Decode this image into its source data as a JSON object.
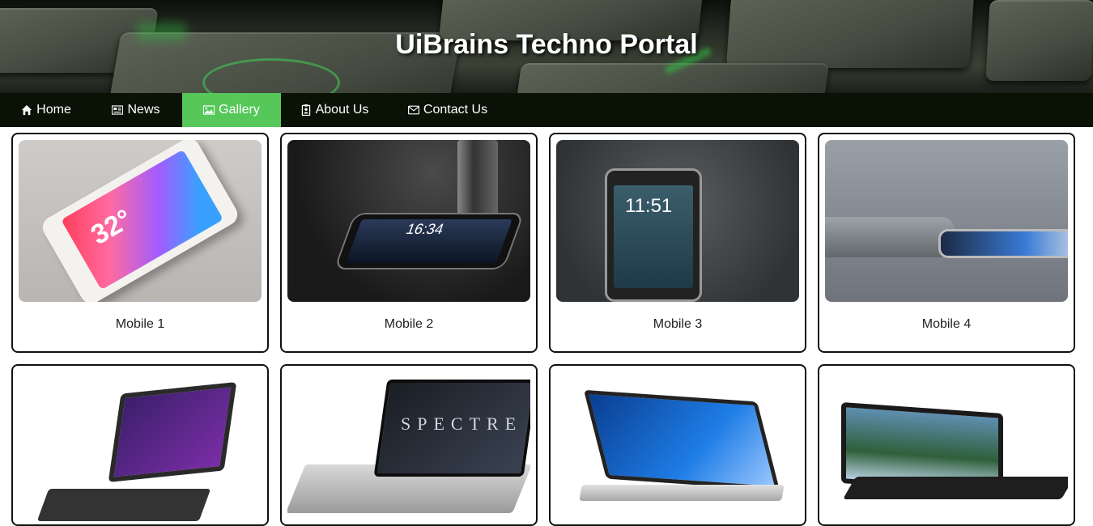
{
  "header": {
    "site_title": "UiBrains Techno Portal"
  },
  "nav": {
    "items": [
      {
        "label": "Home",
        "icon": "home-icon"
      },
      {
        "label": "News",
        "icon": "newspaper-icon"
      },
      {
        "label": "Gallery",
        "icon": "image-icon",
        "active": true
      },
      {
        "label": "About Us",
        "icon": "id-badge-icon"
      },
      {
        "label": "Contact Us",
        "icon": "envelope-icon"
      }
    ],
    "active_color": "#56c85a",
    "background_color": "#0a1105"
  },
  "gallery": {
    "items": [
      {
        "caption": "Mobile 1",
        "phone_time": "32°"
      },
      {
        "caption": "Mobile 2",
        "phone_time": "16:34"
      },
      {
        "caption": "Mobile 3",
        "phone_time": "11:51"
      },
      {
        "caption": "Mobile 4"
      },
      {
        "caption": ""
      },
      {
        "caption": "",
        "screen_text": "SPECTRE"
      },
      {
        "caption": ""
      },
      {
        "caption": ""
      }
    ]
  }
}
